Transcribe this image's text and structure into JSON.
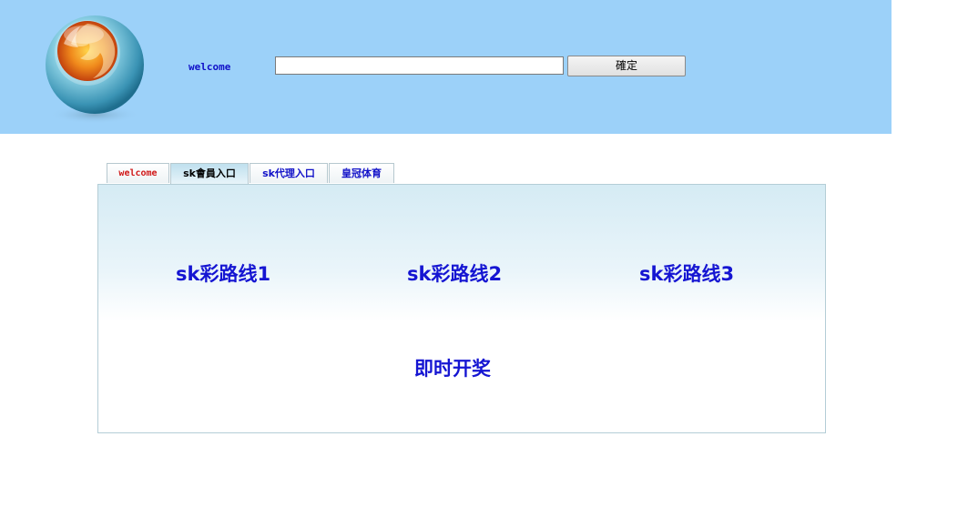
{
  "header": {
    "welcome_label": "welcome",
    "search": {
      "value": "",
      "placeholder": ""
    },
    "confirm_label": "確定"
  },
  "tabs": [
    {
      "label": "welcome",
      "color": "#d01818"
    },
    {
      "label": "sk會員入口",
      "color": "#000000",
      "active": true
    },
    {
      "label": "sk代理入口",
      "color": "#1010c8"
    },
    {
      "label": "皇冠体育",
      "color": "#1010c8"
    }
  ],
  "panel": {
    "links": [
      "sk彩路线1",
      "sk彩路线2",
      "sk彩路线3"
    ],
    "lottery_link": "即时开奖"
  },
  "colors": {
    "header_bg": "#9cd1f9",
    "link_blue": "#1515d2",
    "welcome_red": "#d01818"
  },
  "icons": {
    "logo": "firefox-globe-logo"
  }
}
